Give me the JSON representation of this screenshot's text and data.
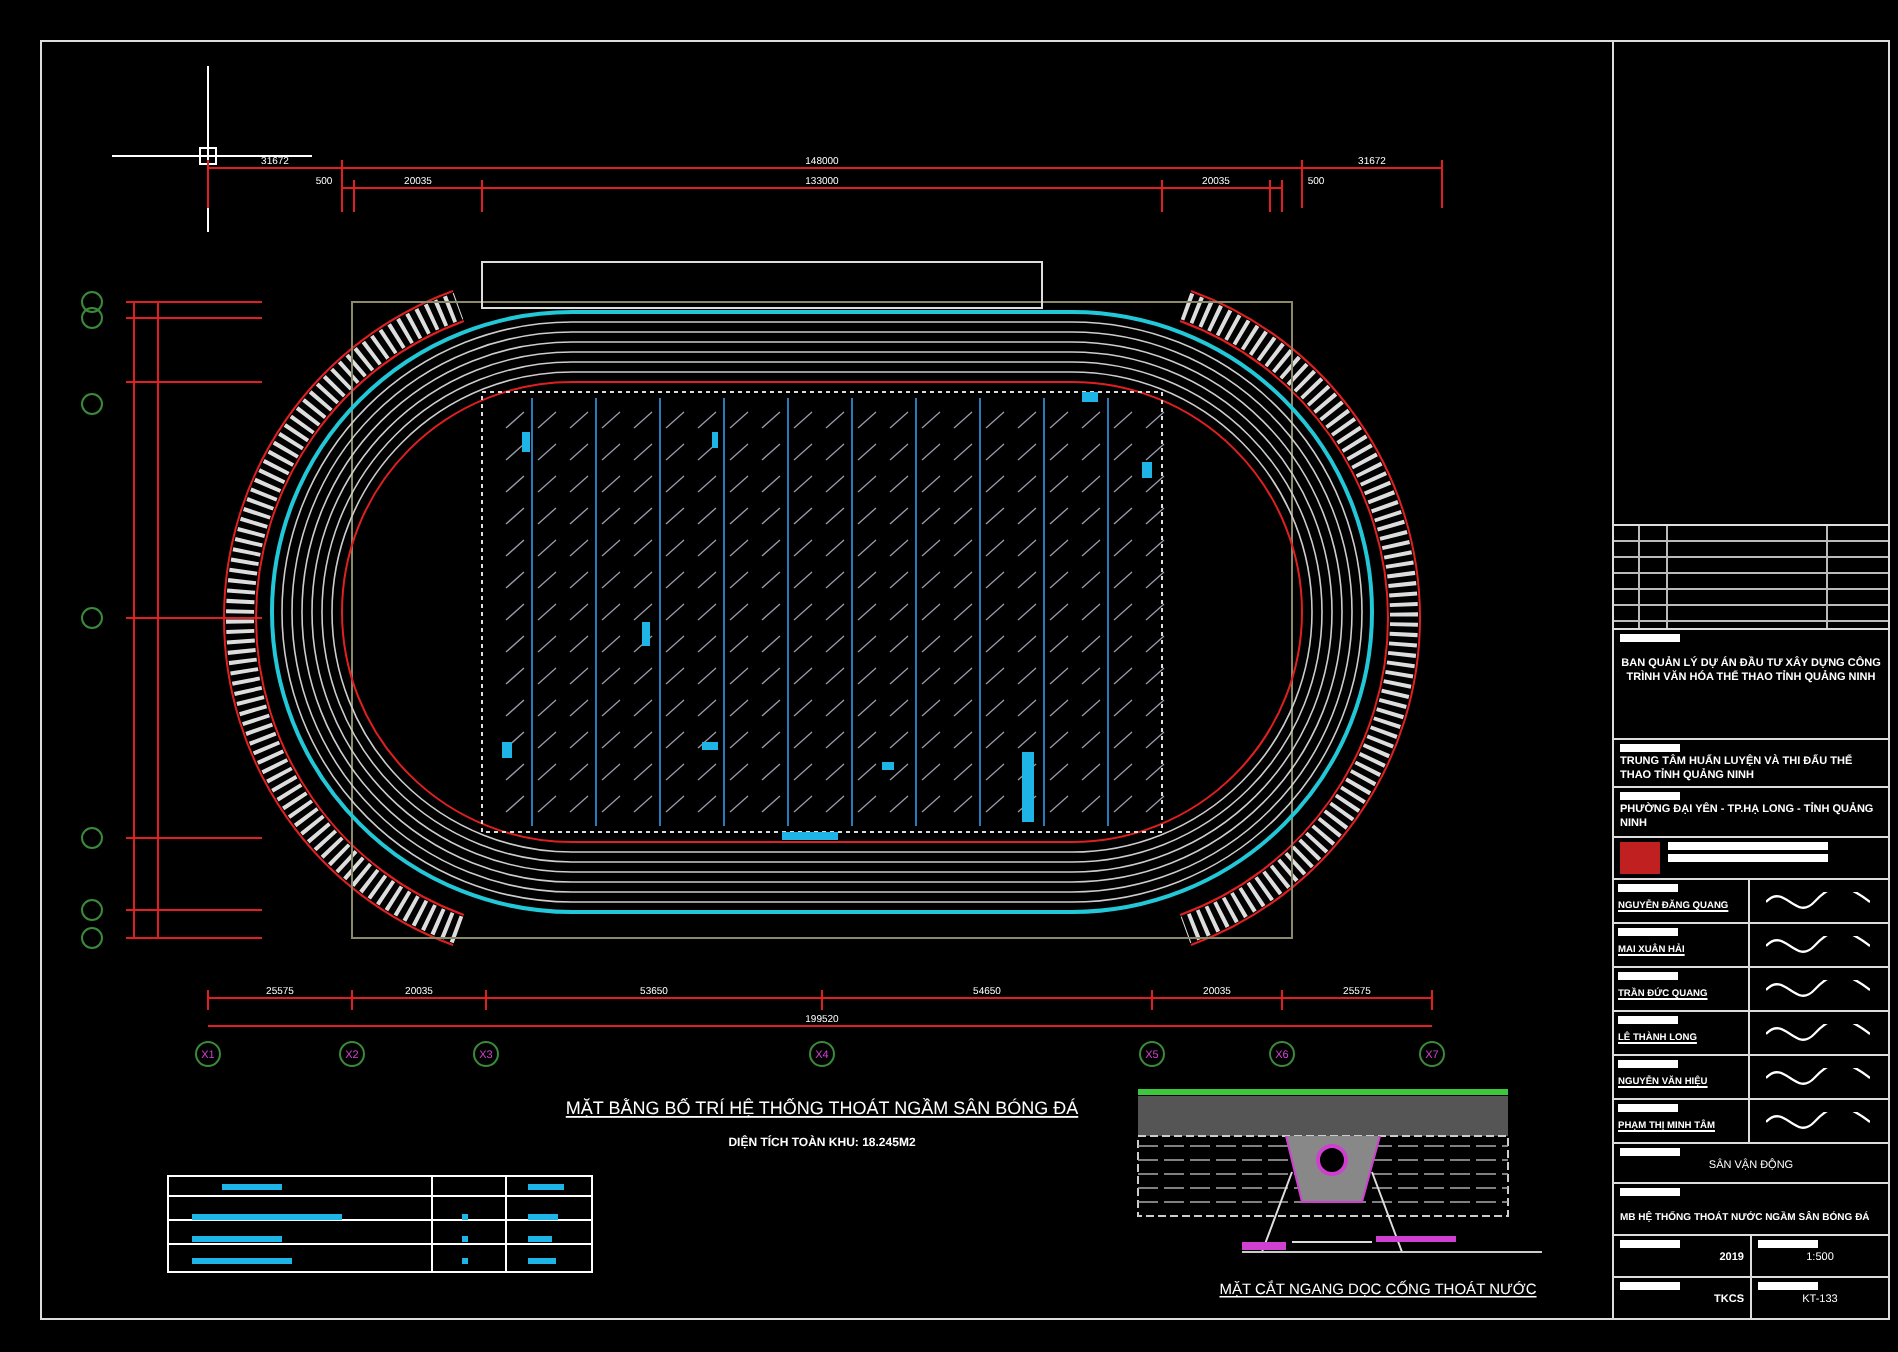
{
  "drawing": {
    "title": "MẶT BẰNG BỐ TRÍ HỆ THỐNG THOÁT NGẦM SÂN BÓNG ĐÁ",
    "area_note": "DIỆN TÍCH TOÀN KHU: 18.245M2",
    "section_caption": "MẶT CẮT NGANG DỌC CỐNG THOÁT NƯỚC",
    "top_dimensions": [
      "31672",
      "148000",
      "31672"
    ],
    "second_dimensions": [
      "500",
      "20035",
      "133000",
      "20035",
      "500"
    ],
    "bottom_dimensions": [
      "25575",
      "20035",
      "53650",
      "54650",
      "20035",
      "25575"
    ],
    "bottom_total": "199520",
    "axes": [
      "X1",
      "X2",
      "X3",
      "X4",
      "X5",
      "X6",
      "X7"
    ]
  },
  "title_block": {
    "client": "BAN QUẢN LÝ DỰ ÁN ĐẦU TƯ XÂY DỰNG CÔNG TRÌNH VĂN HÓA THỂ THAO TỈNH QUẢNG NINH",
    "project": "TRUNG TÂM HUẤN LUYỆN VÀ THI ĐẤU THỂ THAO TỈNH QUẢNG NINH",
    "location": "PHƯỜNG ĐẠI YÊN - TP.HẠ LONG - TỈNH QUẢNG NINH",
    "personnel": [
      {
        "name": "NGUYỄN ĐĂNG QUANG"
      },
      {
        "name": "MAI XUÂN HẢI"
      },
      {
        "name": "TRẦN ĐỨC QUANG"
      },
      {
        "name": "LÊ THÀNH LONG"
      },
      {
        "name": "NGUYỄN VĂN HIỆU"
      },
      {
        "name": "PHẠM THỊ MINH TÂM"
      }
    ],
    "item": "SÂN VẬN ĐỘNG",
    "sheet_title": "MB HỆ THỐNG THOÁT NƯỚC NGẦM SÂN BÓNG ĐÁ",
    "year": "2019",
    "scale": "1:500",
    "phase": "TKCS",
    "sheet_number": "KT-133"
  }
}
